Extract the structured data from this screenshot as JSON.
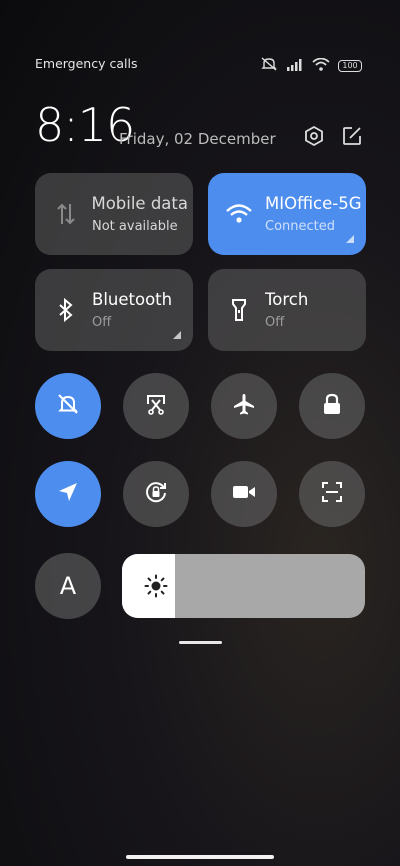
{
  "status_bar": {
    "carrier_text": "Emergency calls only",
    "battery": "100"
  },
  "header": {
    "time": "8:16",
    "date": "Friday, 02 December"
  },
  "tiles": [
    {
      "title": "Mobile data",
      "subtitle": "Not available",
      "active": false
    },
    {
      "title": "MIOffice-5G",
      "subtitle": "Connected",
      "active": true
    },
    {
      "title": "Bluetooth",
      "subtitle": "Off",
      "active": false
    },
    {
      "title": "Torch",
      "subtitle": "Off",
      "active": false
    }
  ],
  "toggles": [
    {
      "icon": "silent-bell-icon",
      "on": true
    },
    {
      "icon": "screenshot-icon",
      "on": false
    },
    {
      "icon": "airplane-icon",
      "on": false
    },
    {
      "icon": "lock-icon",
      "on": false
    },
    {
      "icon": "location-icon",
      "on": true
    },
    {
      "icon": "rotation-lock-icon",
      "on": false
    },
    {
      "icon": "video-camera-icon",
      "on": false
    },
    {
      "icon": "scanner-icon",
      "on": false
    }
  ],
  "reading_mode": {
    "label": "A"
  },
  "brightness": {
    "level": 0.22,
    "icon": "sun-icon"
  },
  "colors": {
    "accent": "#4d8dee",
    "tile": "#5f5f5f"
  }
}
